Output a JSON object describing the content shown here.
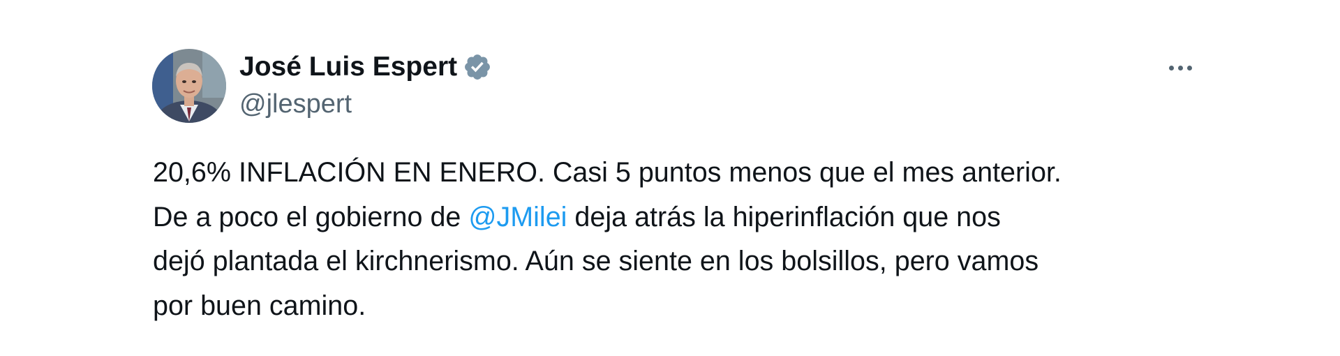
{
  "author": {
    "display_name": "José Luis Espert",
    "handle": "@jlespert",
    "verified": true,
    "verified_icon": "verified-badge-icon",
    "verified_color": "#7a94a7"
  },
  "tweet": {
    "lines": [
      {
        "text": "20,6% INFLACIÓN EN ENERO. Casi 5 puntos menos que el mes anterior."
      },
      {
        "before": "De a poco el gobierno de ",
        "mention": "@JMilei",
        "after": " deja atrás la hiperinflación que nos"
      },
      {
        "text": "dejó plantada el kirchnerismo. Aún se siente en los bolsillos, pero vamos"
      },
      {
        "text": "por buen camino."
      }
    ]
  },
  "more_menu": {
    "icon": "more-horizontal-icon"
  },
  "colors": {
    "text": "#0f1419",
    "secondary": "#536471",
    "mention": "#1d9bf0",
    "background": "#ffffff"
  }
}
